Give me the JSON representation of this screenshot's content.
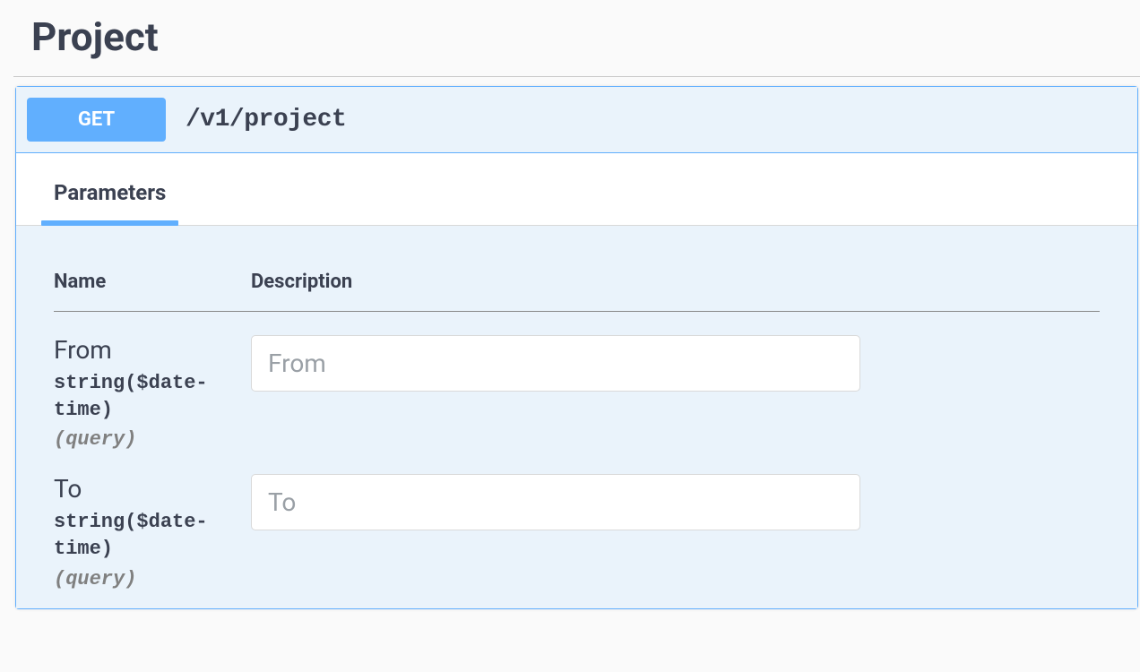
{
  "section": {
    "title": "Project"
  },
  "operation": {
    "method": "GET",
    "path": "/v1/project"
  },
  "tabs": {
    "parameters": "Parameters"
  },
  "table": {
    "headers": {
      "name": "Name",
      "description": "Description"
    }
  },
  "parameters": [
    {
      "name": "From",
      "type": "string($date-time)",
      "in": "(query)",
      "placeholder": "From"
    },
    {
      "name": "To",
      "type": "string($date-time)",
      "in": "(query)",
      "placeholder": "To"
    }
  ]
}
